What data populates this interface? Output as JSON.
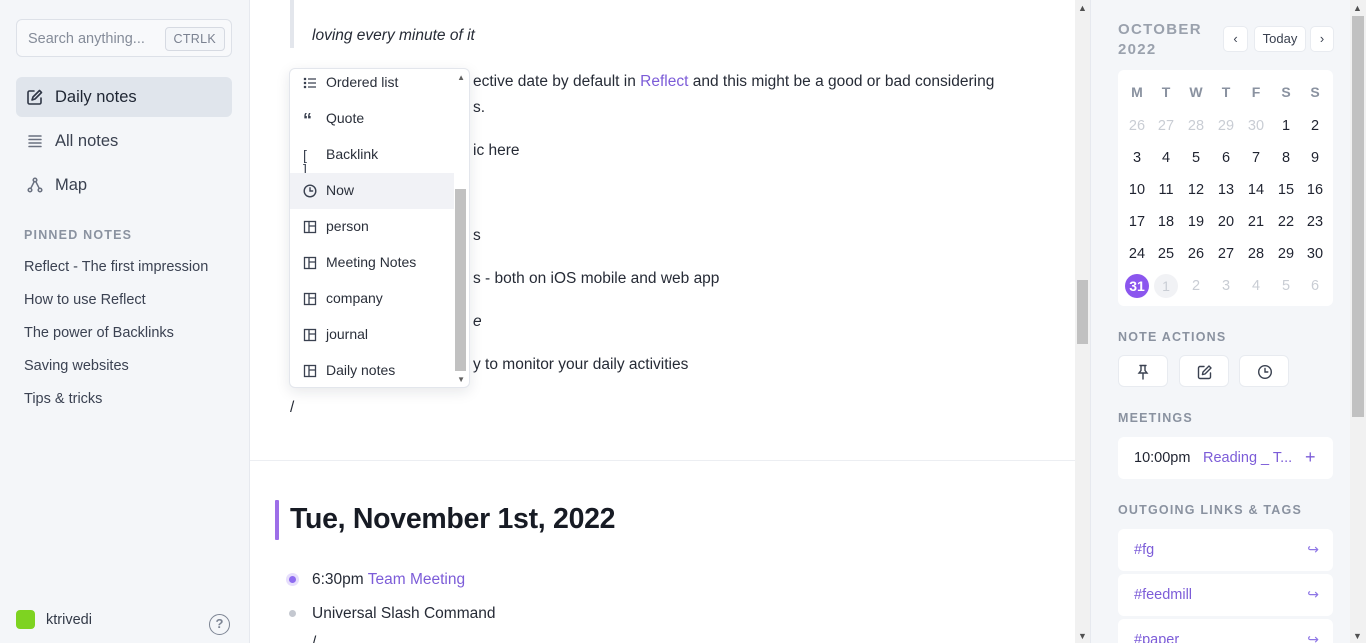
{
  "sidebar": {
    "search_placeholder": "Search anything...",
    "search_shortcut": "CTRLK",
    "nav": [
      {
        "label": "Daily notes",
        "icon": "edit-icon",
        "active": true
      },
      {
        "label": "All notes",
        "icon": "list-icon",
        "active": false
      },
      {
        "label": "Map",
        "icon": "graph-icon",
        "active": false
      }
    ],
    "pinned_heading": "PINNED NOTES",
    "pinned": [
      "Reflect - The first impression",
      "How to use Reflect",
      "The power of Backlinks",
      "Saving websites",
      "Tips & tricks"
    ],
    "user": "ktrivedi",
    "help": "?",
    "avatar_color": "#7ed321"
  },
  "editor": {
    "quote": "loving every minute of it",
    "lines": [
      {
        "pre": "ective date by default in ",
        "link": "Reflect",
        "post": " and this might be a good or bad considering"
      },
      {
        "pre": "s.",
        "link": "",
        "post": ""
      },
      {
        "pre": "ic here",
        "link": "",
        "post": ""
      },
      {
        "pre": "s",
        "link": "",
        "post": ""
      },
      {
        "pre": "s - both on iOS mobile and web app",
        "link": "",
        "post": ""
      },
      {
        "pre": "e",
        "link": "",
        "post": ""
      },
      {
        "pre": "y to monitor your daily activities",
        "link": "",
        "post": ""
      }
    ],
    "slash": "/",
    "day_title": "Tue, November 1st, 2022",
    "items": [
      {
        "time": "6:30pm ",
        "link": "Team Meeting",
        "text": ""
      },
      {
        "time": "",
        "link": "",
        "text": "Universal Slash Command"
      }
    ],
    "trailing": "/",
    "accent": "#9d6ee8"
  },
  "slash_menu": {
    "items": [
      {
        "label": "Ordered list",
        "icon": "ordered-list-icon"
      },
      {
        "label": "Quote",
        "icon": "quote-icon"
      },
      {
        "label": "Backlink",
        "icon": "brackets-icon"
      },
      {
        "label": "Now",
        "icon": "clock-icon",
        "selected": true
      },
      {
        "label": "person",
        "icon": "template-icon"
      },
      {
        "label": "Meeting Notes",
        "icon": "template-icon"
      },
      {
        "label": "company",
        "icon": "template-icon"
      },
      {
        "label": "journal",
        "icon": "template-icon"
      },
      {
        "label": "Daily notes",
        "icon": "template-icon"
      }
    ]
  },
  "calendar": {
    "month": "OCTOBER",
    "year": "2022",
    "today_btn": "Today",
    "prev": "‹",
    "next": "›",
    "dow": [
      "M",
      "T",
      "W",
      "T",
      "F",
      "S",
      "S"
    ],
    "weeks": [
      [
        "26",
        "27",
        "28",
        "29",
        "30",
        "1",
        "2"
      ],
      [
        "3",
        "4",
        "5",
        "6",
        "7",
        "8",
        "9"
      ],
      [
        "10",
        "11",
        "12",
        "13",
        "14",
        "15",
        "16"
      ],
      [
        "17",
        "18",
        "19",
        "20",
        "21",
        "22",
        "23"
      ],
      [
        "24",
        "25",
        "26",
        "27",
        "28",
        "29",
        "30"
      ],
      [
        "31",
        "1",
        "2",
        "3",
        "4",
        "5",
        "6"
      ]
    ],
    "selected_day": "31",
    "selected_color": "#8b56ee"
  },
  "note_actions": {
    "heading": "NOTE ACTIONS",
    "buttons": [
      "pin-icon",
      "edit-icon",
      "clock-icon"
    ]
  },
  "meetings": {
    "heading": "MEETINGS",
    "time": "10:00pm",
    "name": "Reading _ T...",
    "add": "+"
  },
  "links": {
    "heading": "OUTGOING LINKS & TAGS",
    "tags": [
      "#fg",
      "#feedmill",
      "#paper"
    ],
    "arrow": "↪"
  }
}
